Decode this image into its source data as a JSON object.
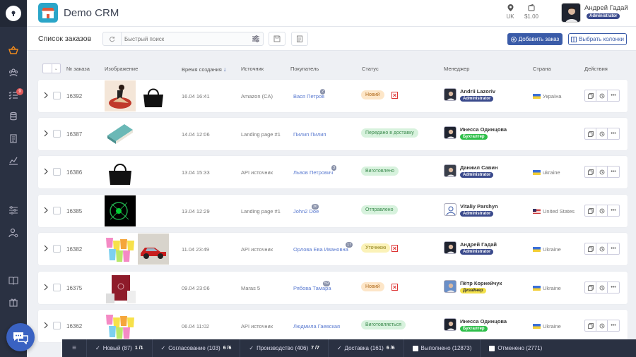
{
  "header": {
    "brand": "Demo CRM",
    "lang": "UK",
    "balance": "$1.00",
    "user_name": "Андрей Гадай",
    "user_role": "Administrator"
  },
  "sidebar": {
    "orders_badge": "9"
  },
  "toolbar": {
    "title": "Список заказов",
    "search_placeholder": "Быстрый поиск",
    "add_order": "Добавить заказ",
    "choose_columns": "Выбрать колонки"
  },
  "table": {
    "headers": {
      "number": "№ заказа",
      "image": "Изображение",
      "created": "Время создания",
      "source": "Источник",
      "buyer": "Покупатель",
      "status": "Статус",
      "manager": "Менеджер",
      "country": "Страна",
      "actions": "Действия"
    },
    "rows": [
      {
        "id": "16392",
        "date": "16.04 16:41",
        "source": "Amazon (CA)",
        "buyer": "Вася Петров",
        "buyer_count": "2",
        "status": "Новий",
        "manager": "Andrii Lazoriv",
        "role": "Administrator",
        "country": "Україна"
      },
      {
        "id": "16387",
        "date": "14.04 12:06",
        "source": "Landing page #1",
        "buyer": "Пилип Пилип",
        "buyer_count": "",
        "status": "Передано в доставку",
        "manager": "Инесса Одинцова",
        "role": "Бухгалтер",
        "country": ""
      },
      {
        "id": "16386",
        "date": "13.04 15:33",
        "source": "API источник",
        "buyer": "Львов Петрович",
        "buyer_count": "3",
        "status": "Виготовлено",
        "manager": "Даниил Савин",
        "role": "Administrator",
        "country": "ukraine"
      },
      {
        "id": "16385",
        "date": "13.04 12:29",
        "source": "Landing page #1",
        "buyer": "John2 Doe",
        "buyer_count": "30",
        "status": "Отправлено",
        "manager": "Vitaliy Parshyn",
        "role": "Administrator",
        "country": "United States"
      },
      {
        "id": "16382",
        "date": "11.04 23:49",
        "source": "API источник",
        "buyer": "Орлова Ева Ивановна",
        "buyer_count": "17",
        "status": "Уточнюю",
        "manager": "Андрей Гадай",
        "role": "Administrator",
        "country": "Ukraine"
      },
      {
        "id": "16375",
        "date": "09.04 23:06",
        "source": "Maras 5",
        "buyer": "Рябова Тамара",
        "buyer_count": "59",
        "status": "Новий",
        "manager": "Пётр Корнейчук",
        "role": "Дизайнер",
        "country": "Ukraine"
      },
      {
        "id": "16362",
        "date": "06.04 11:02",
        "source": "API источник",
        "buyer": "Людмила Гаевская",
        "buyer_count": "",
        "status": "Виготовляється",
        "manager": "Инесса Одинцова",
        "role": "Бухгалтер",
        "country": "Ukraine"
      }
    ]
  },
  "footer": {
    "items": [
      {
        "label": "Новый (87)",
        "sub": "1 /1"
      },
      {
        "label": "Согласование (103)",
        "sub": "6 /6"
      },
      {
        "label": "Производство (406)",
        "sub": "7 /7"
      },
      {
        "label": "Доставка (161)",
        "sub": "6 /6"
      },
      {
        "label": "Выполнено (12873)",
        "sub": ""
      },
      {
        "label": "Отменено (2771)",
        "sub": ""
      }
    ]
  },
  "colors": {
    "sidebar_bg": "#2a3142",
    "accent": "#3a5ba8",
    "status_new": "#fde6c8",
    "status_green": "#d7f2dd",
    "status_yellow": "#fbf2b8",
    "role_admin": "#3a4a8c",
    "role_green": "#2fbf4a",
    "role_yellow": "#f3e14a"
  }
}
